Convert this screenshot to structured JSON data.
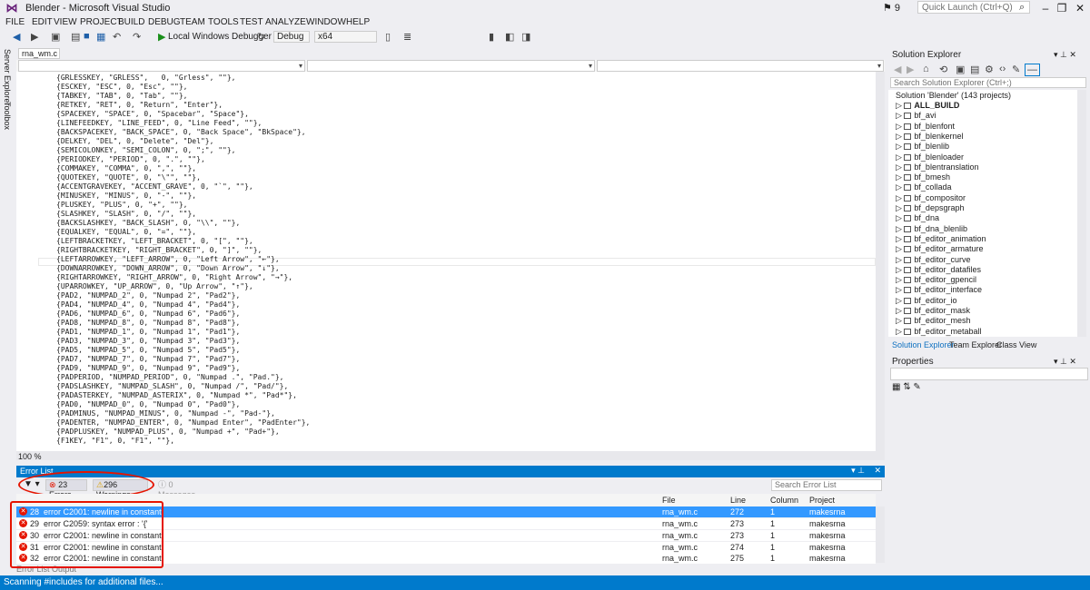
{
  "window": {
    "title": "Blender - Microsoft Visual Studio",
    "notif_count": "9",
    "quick_launch_placeholder": "Quick Launch (Ctrl+Q)"
  },
  "menu": [
    "FILE",
    "EDIT",
    "VIEW",
    "PROJECT",
    "BUILD",
    "DEBUG",
    "TEAM",
    "TOOLS",
    "TEST",
    "ANALYZE",
    "WINDOW",
    "HELP"
  ],
  "toolbar": {
    "debugger_label": "Local Windows Debugger",
    "config": "Debug",
    "platform": "x64"
  },
  "left_rail": {
    "server_explorer": "Server Explorer",
    "toolbox": "Toolbox"
  },
  "editor": {
    "tab": "rna_wm.c",
    "zoom": "100 %",
    "code_lines": [
      "{GRLESSKEY, \"GRLESS\",   0, \"Grless\", \"\"},",
      "{ESCKEY, \"ESC\", 0, \"Esc\", \"\"},",
      "{TABKEY, \"TAB\", 0, \"Tab\", \"\"},",
      "{RETKEY, \"RET\", 0, \"Return\", \"Enter\"},",
      "{SPACEKEY, \"SPACE\", 0, \"Spacebar\", \"Space\"},",
      "{LINEFEEDKEY, \"LINE_FEED\", 0, \"Line Feed\", \"\"},",
      "{BACKSPACEKEY, \"BACK_SPACE\", 0, \"Back Space\", \"BkSpace\"},",
      "{DELKEY, \"DEL\", 0, \"Delete\", \"Del\"},",
      "{SEMICOLONKEY, \"SEMI_COLON\", 0, \";\", \"\"},",
      "{PERIODKEY, \"PERIOD\", 0, \".\", \"\"},",
      "{COMMAKEY, \"COMMA\", 0, \",\", \"\"},",
      "{QUOTEKEY, \"QUOTE\", 0, \"\\\"\", \"\"},",
      "{ACCENTGRAVEKEY, \"ACCENT_GRAVE\", 0, \"`\", \"\"},",
      "{MINUSKEY, \"MINUS\", 0, \"-\", \"\"},",
      "{PLUSKEY, \"PLUS\", 0, \"+\", \"\"},",
      "{SLASHKEY, \"SLASH\", 0, \"/\", \"\"},",
      "{BACKSLASHKEY, \"BACK_SLASH\", 0, \"\\\\\", \"\"},",
      "{EQUALKEY, \"EQUAL\", 0, \"=\", \"\"},",
      "{LEFTBRACKETKEY, \"LEFT_BRACKET\", 0, \"[\", \"\"},",
      "{RIGHTBRACKETKEY, \"RIGHT_BRACKET\", 0, \"]\", \"\"},",
      "{LEFTARROWKEY, \"LEFT_ARROW\", 0, \"Left Arrow\", \"←\"},",
      "{DOWNARROWKEY, \"DOWN_ARROW\", 0, \"Down Arrow\", \"↓\"},",
      "{RIGHTARROWKEY, \"RIGHT_ARROW\", 0, \"Right Arrow\", \"→\"},",
      "{UPARROWKEY, \"UP_ARROW\", 0, \"Up Arrow\", \"↑\"},",
      "{PAD2, \"NUMPAD_2\", 0, \"Numpad 2\", \"Pad2\"},",
      "{PAD4, \"NUMPAD_4\", 0, \"Numpad 4\", \"Pad4\"},",
      "{PAD6, \"NUMPAD_6\", 0, \"Numpad 6\", \"Pad6\"},",
      "{PAD8, \"NUMPAD_8\", 0, \"Numpad 8\", \"Pad8\"},",
      "{PAD1, \"NUMPAD_1\", 0, \"Numpad 1\", \"Pad1\"},",
      "{PAD3, \"NUMPAD_3\", 0, \"Numpad 3\", \"Pad3\"},",
      "{PAD5, \"NUMPAD_5\", 0, \"Numpad 5\", \"Pad5\"},",
      "{PAD7, \"NUMPAD_7\", 0, \"Numpad 7\", \"Pad7\"},",
      "{PAD9, \"NUMPAD_9\", 0, \"Numpad 9\", \"Pad9\"},",
      "{PADPERIOD, \"NUMPAD_PERIOD\", 0, \"Numpad .\", \"Pad.\"},",
      "{PADSLASHKEY, \"NUMPAD_SLASH\", 0, \"Numpad /\", \"Pad/\"},",
      "{PADASTERKEY, \"NUMPAD_ASTERIX\", 0, \"Numpad *\", \"Pad*\"},",
      "{PAD0, \"NUMPAD_0\", 0, \"Numpad 0\", \"Pad0\"},",
      "{PADMINUS, \"NUMPAD_MINUS\", 0, \"Numpad -\", \"Pad-\"},",
      "{PADENTER, \"NUMPAD_ENTER\", 0, \"Numpad Enter\", \"PadEnter\"},",
      "{PADPLUSKEY, \"NUMPAD_PLUS\", 0, \"Numpad +\", \"Pad+\"},",
      "{F1KEY, \"F1\", 0, \"F1\", \"\"},"
    ]
  },
  "error_list": {
    "title": "Error List",
    "errors_btn": "23 Errors",
    "warnings_btn": "296 Warnings",
    "messages_btn": "0 Messages",
    "search_placeholder": "Search Error List",
    "columns": {
      "file": "File",
      "line": "Line",
      "column": "Column",
      "project": "Project"
    },
    "rows": [
      {
        "num": "28",
        "desc": "error C2001: newline in constant",
        "file": "rna_wm.c",
        "line": "272",
        "column": "1",
        "project": "makesrna"
      },
      {
        "num": "29",
        "desc": "error C2059: syntax error : '{'",
        "file": "rna_wm.c",
        "line": "273",
        "column": "1",
        "project": "makesrna"
      },
      {
        "num": "30",
        "desc": "error C2001: newline in constant",
        "file": "rna_wm.c",
        "line": "273",
        "column": "1",
        "project": "makesrna"
      },
      {
        "num": "31",
        "desc": "error C2001: newline in constant",
        "file": "rna_wm.c",
        "line": "274",
        "column": "1",
        "project": "makesrna"
      },
      {
        "num": "32",
        "desc": "error C2001: newline in constant",
        "file": "rna_wm.c",
        "line": "275",
        "column": "1",
        "project": "makesrna"
      }
    ],
    "bottom_tabs": "Error List   Output"
  },
  "status": "Scanning #includes for additional files...",
  "solution_explorer": {
    "title": "Solution Explorer",
    "search_placeholder": "Search Solution Explorer (Ctrl+;)",
    "solution": "Solution 'Blender' (143 projects)",
    "projects": [
      "ALL_BUILD",
      "bf_avi",
      "bf_blenfont",
      "bf_blenkernel",
      "bf_blenlib",
      "bf_blenloader",
      "bf_blentranslation",
      "bf_bmesh",
      "bf_collada",
      "bf_compositor",
      "bf_depsgraph",
      "bf_dna",
      "bf_dna_blenlib",
      "bf_editor_animation",
      "bf_editor_armature",
      "bf_editor_curve",
      "bf_editor_datafiles",
      "bf_editor_gpencil",
      "bf_editor_interface",
      "bf_editor_io",
      "bf_editor_mask",
      "bf_editor_mesh",
      "bf_editor_metaball"
    ],
    "tabs": [
      "Solution Explorer",
      "Team Explorer",
      "Class View"
    ]
  },
  "properties": {
    "title": "Properties"
  },
  "colors": {
    "accent": "#007acc",
    "error": "#e51400",
    "selection": "#3399ff"
  }
}
